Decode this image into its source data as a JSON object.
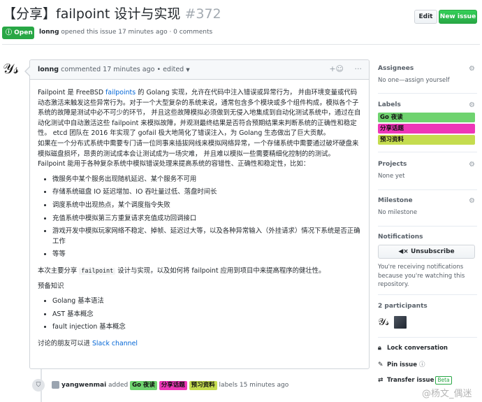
{
  "header": {
    "title": "【分享】failpoint 设计与实现",
    "number": "#372",
    "edit_label": "Edit",
    "new_issue_label": "New issue"
  },
  "meta": {
    "state": "Open",
    "author": "lonng",
    "opened_text": "opened this issue 17 minutes ago · 0 comments"
  },
  "comment": {
    "author": "lonng",
    "commented_text": "commented 17 minutes ago",
    "edited_text": "• edited",
    "add_reaction_icon": "smiley-icon",
    "more_icon": "kebab-icon",
    "p1_pre": "Failpoint 是 FreeBSD ",
    "p1_link": "failpoints",
    "p1_post": " 的 Golang 实现，允许在代码中注入错误或异常行为， 并由环境变量或代码动态激活来触发这些异常行为。对于一个大型复杂的系统来说，通常包含多个模块或多个组件构成，模拟各个子系统的故障是测试中必不可少的环节， 并且这些故障模拟必须做到无侵入地集成到自动化测试系统中，通过在自动化测试中自动激活这些 failpoint 来模拟故障，并观测最终结果是否符合预期结果来判断系统的正确性和稳定性。 etcd 团队在 2016 年实现了 gofail 极大地简化了错误注入，为 Golang 生态做出了巨大贡献。",
    "p2": "如果在一个分布式系统中需要专门请一位同事来插拔网线来模拟网络异常，一个存储系统中需要通过破坏硬盘来模拟磁盘损坏，昂贵的测试成本会让测试成为一场灾难， 并且难以模拟一些需要精细化控制的的测试。Failpoint 能用于各种复杂系统中模拟错误处理来提高系统的容错性、正确性和稳定性，比如：",
    "bullets": [
      "微服务中某个服务出现随机延迟、某个服务不可用",
      "存储系统磁盘 IO 延迟增加、IO 吞吐量过低、落盘时间长",
      "调度系统中出现热点，某个调度指令失败",
      "充值系统中模拟第三方重复请求充值成功回调接口",
      "游戏开发中模拟玩家网络不稳定、掉帧、延迟过大等，以及各种异常输入（外挂请求）情况下系统是否正确工作",
      "等等"
    ],
    "p3_pre": "本次主要分享 ",
    "p3_code": "failpoint",
    "p3_post": " 设计与实现，以及如何将 failpoint 应用到项目中来提高程序的健壮性。",
    "prereq_title": "预备知识",
    "prereqs": [
      "Golang 基本语法",
      "AST 基本概念",
      "fault injection 基本概念"
    ],
    "footer_pre": "讨论的朋友可以进 ",
    "footer_link": "Slack channel"
  },
  "event": {
    "icon": "tag-icon",
    "actor": "yangwenmai",
    "added": "added",
    "labels_text": "labels 15 minutes ago"
  },
  "labels": [
    {
      "name": "Go 夜读",
      "color": "#6fd36f"
    },
    {
      "name": "分享话题",
      "color": "#ee37b8"
    },
    {
      "name": "预习资料",
      "color": "#c5dc4f"
    }
  ],
  "sidebar": {
    "assignees_title": "Assignees",
    "assignees_text": "No one—assign yourself",
    "labels_title": "Labels",
    "projects_title": "Projects",
    "projects_text": "None yet",
    "milestone_title": "Milestone",
    "milestone_text": "No milestone",
    "notifications_title": "Notifications",
    "unsubscribe_label": "Unsubscribe",
    "notifications_note": "You're receiving notifications because you're watching this repository.",
    "participants_title": "2 participants",
    "lock_label": "Lock conversation",
    "pin_label": "Pin issue",
    "transfer_label": "Transfer issue",
    "beta_label": "Beta"
  },
  "watermark": "@杨文_偶迷"
}
